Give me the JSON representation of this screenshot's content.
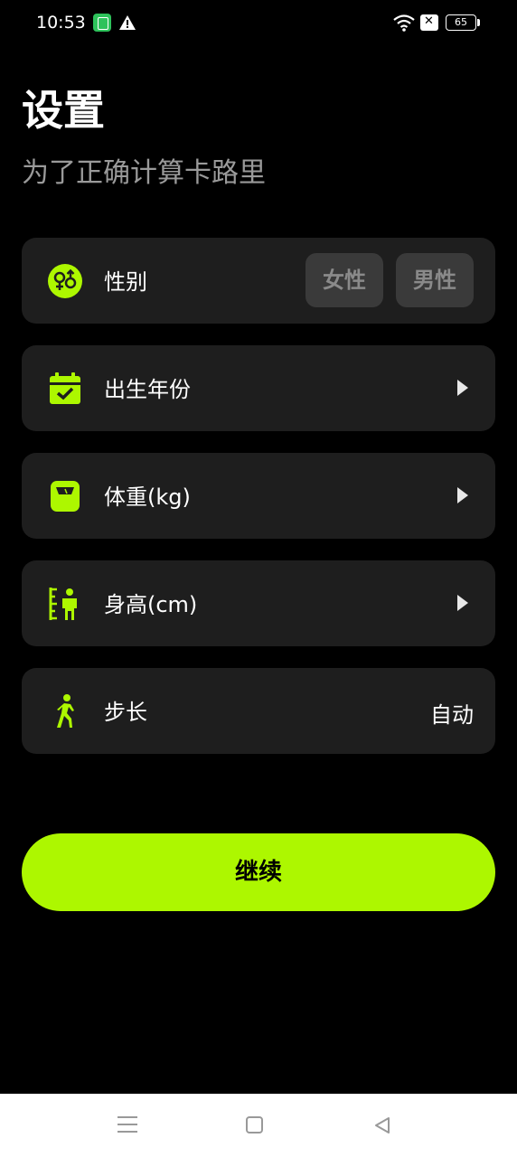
{
  "status": {
    "time": "10:53",
    "battery": "65"
  },
  "header": {
    "title": "设置",
    "subtitle": "为了正确计算卡路里"
  },
  "settings": {
    "gender": {
      "label": "性别",
      "female": "女性",
      "male": "男性"
    },
    "birth_year": {
      "label": "出生年份"
    },
    "weight": {
      "label": "体重(kg)"
    },
    "height": {
      "label": "身高(cm)"
    },
    "stride": {
      "label": "步长",
      "value": "自动"
    }
  },
  "actions": {
    "continue": "继续"
  },
  "colors": {
    "accent": "#adf700",
    "card": "#1e1e1e",
    "background": "#000000"
  },
  "icons": [
    "gender-icon",
    "calendar-icon",
    "scale-icon",
    "height-icon",
    "walking-icon",
    "chevron-right-icon"
  ]
}
